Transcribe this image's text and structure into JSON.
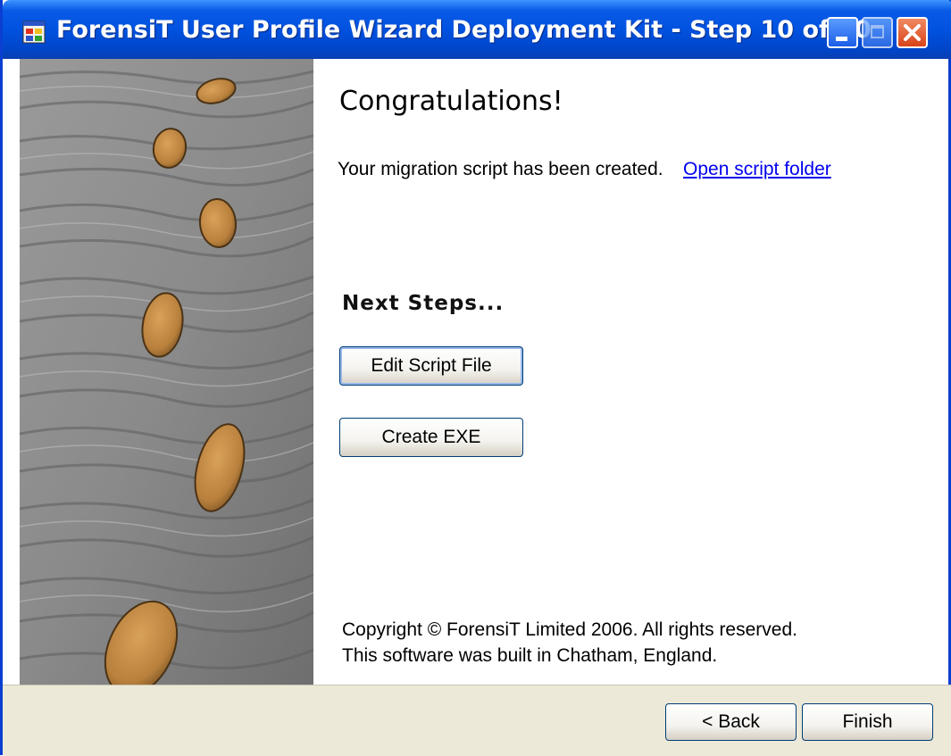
{
  "window": {
    "title": "ForensiT User Profile Wizard Deployment Kit - Step 10 of 10",
    "icon": "app-window-icon",
    "controls": [
      "minimize-icon",
      "maximize-icon",
      "close-icon"
    ]
  },
  "sidebar": {
    "image": "footprints-in-sand"
  },
  "main": {
    "heading": "Congratulations!",
    "message": "Your migration script has been created.",
    "link_label": "Open script folder",
    "next_steps_heading": "Next Steps...",
    "edit_button_label": "Edit Script File",
    "exe_button_label": "Create EXE",
    "copyright_line1": "Copyright © ForensiT Limited 2006. All rights reserved.",
    "copyright_line2": "This software was built in Chatham, England."
  },
  "footer": {
    "back_label": "< Back",
    "finish_label": "Finish"
  },
  "colors": {
    "titlebar": "#0052e0",
    "link": "#0000ee",
    "footer_background": "#ece9d8",
    "button_border": "#003c74"
  }
}
